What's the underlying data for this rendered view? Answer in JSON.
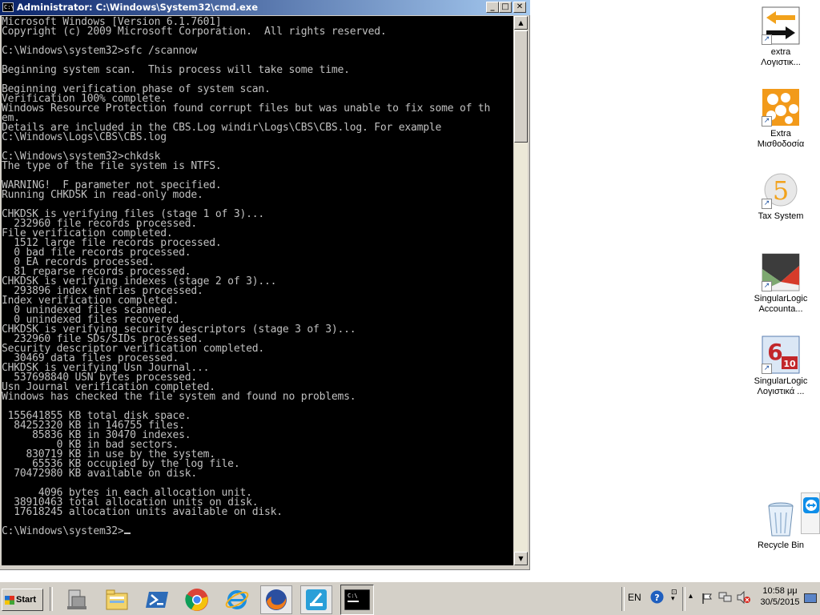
{
  "window": {
    "title": "Administrator: C:\\Windows\\System32\\cmd.exe",
    "icon_text": "C:\\",
    "minimize": "_",
    "maximize": "□",
    "close": "✕"
  },
  "console_lines": [
    "Microsoft Windows [Version 6.1.7601]",
    "Copyright (c) 2009 Microsoft Corporation.  All rights reserved.",
    "",
    "C:\\Windows\\system32>sfc /scannow",
    "",
    "Beginning system scan.  This process will take some time.",
    "",
    "Beginning verification phase of system scan.",
    "Verification 100% complete.",
    "Windows Resource Protection found corrupt files but was unable to fix some of th",
    "em.",
    "Details are included in the CBS.Log windir\\Logs\\CBS\\CBS.log. For example",
    "C:\\Windows\\Logs\\CBS\\CBS.log",
    "",
    "C:\\Windows\\system32>chkdsk",
    "The type of the file system is NTFS.",
    "",
    "WARNING!  F parameter not specified.",
    "Running CHKDSK in read-only mode.",
    "",
    "CHKDSK is verifying files (stage 1 of 3)...",
    "  232960 file records processed.",
    "File verification completed.",
    "  1512 large file records processed.",
    "  0 bad file records processed.",
    "  0 EA records processed.",
    "  81 reparse records processed.",
    "CHKDSK is verifying indexes (stage 2 of 3)...",
    "  293896 index entries processed.",
    "Index verification completed.",
    "  0 unindexed files scanned.",
    "  0 unindexed files recovered.",
    "CHKDSK is verifying security descriptors (stage 3 of 3)...",
    "  232960 file SDs/SIDs processed.",
    "Security descriptor verification completed.",
    "  30469 data files processed.",
    "CHKDSK is verifying Usn Journal...",
    "  537698840 USN bytes processed.",
    "Usn Journal verification completed.",
    "Windows has checked the file system and found no problems.",
    "",
    " 155641855 KB total disk space.",
    "  84252320 KB in 146755 files.",
    "     85836 KB in 30470 indexes.",
    "         0 KB in bad sectors.",
    "    830719 KB in use by the system.",
    "     65536 KB occupied by the log file.",
    "  70472980 KB available on disk.",
    "",
    "      4096 bytes in each allocation unit.",
    "  38910463 total allocation units on disk.",
    "  17618245 allocation units available on disk.",
    "",
    "C:\\Windows\\system32>"
  ],
  "desktop_icons": [
    {
      "label": "extra\nΛογιστικ...",
      "icon": "extra-logistiki-icon"
    },
    {
      "label": "Extra\nΜισθοδοσία",
      "icon": "extra-misthodosia-icon"
    },
    {
      "label": "Tax System",
      "icon": "tax-system-icon"
    },
    {
      "label": "SingularLogic\nAccounta...",
      "icon": "singularlogic-accounting-icon"
    },
    {
      "label": "SingularLogic\nΛογιστικά ...",
      "icon": "singularlogic-logistika-icon"
    },
    {
      "label": "Recycle Bin",
      "icon": "recycle-bin-icon"
    }
  ],
  "taskbar": {
    "start_label": "Start",
    "apps": [
      "explorer-icon",
      "libraries-icon",
      "powershell-icon",
      "chrome-icon",
      "internet-explorer-icon",
      "firefox-icon",
      "app-icon",
      "cmd-icon"
    ],
    "language": "EN",
    "time": "10:58 μμ",
    "date": "30/5/2015"
  }
}
